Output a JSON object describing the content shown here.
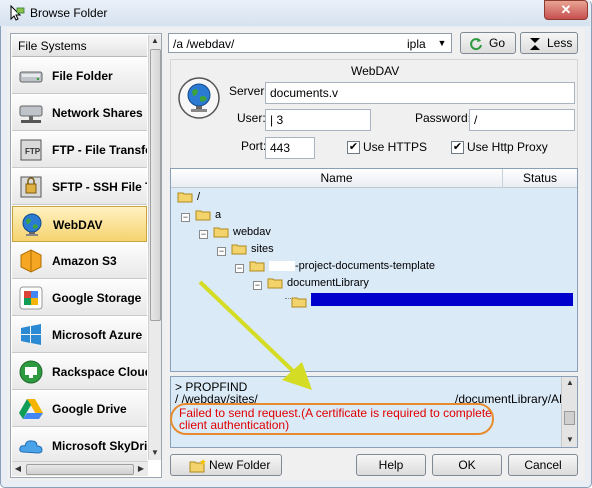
{
  "window": {
    "title": "Browse Folder",
    "close": "✕"
  },
  "file_systems": {
    "header": "File Systems",
    "items": [
      {
        "label": "File Folder",
        "icon": "drive-icon",
        "selected": false
      },
      {
        "label": "Network Shares",
        "icon": "network-drive-icon",
        "selected": false
      },
      {
        "label": "FTP - File Transfer",
        "icon": "ftp-icon",
        "selected": false
      },
      {
        "label": "SFTP - SSH File Tr",
        "icon": "sftp-icon",
        "selected": false
      },
      {
        "label": "WebDAV",
        "icon": "globe-icon",
        "selected": true
      },
      {
        "label": "Amazon S3",
        "icon": "amazon-s3-icon",
        "selected": false
      },
      {
        "label": "Google Storage",
        "icon": "google-icon",
        "selected": false
      },
      {
        "label": "Microsoft Azure",
        "icon": "windows-icon",
        "selected": false
      },
      {
        "label": "Rackspace Cloud",
        "icon": "rackspace-icon",
        "selected": false
      },
      {
        "label": "Google Drive",
        "icon": "google-drive-icon",
        "selected": false
      },
      {
        "label": "Microsoft SkyDriv",
        "icon": "skydrive-icon",
        "selected": false
      }
    ]
  },
  "path": {
    "value": "/a          /webdav/",
    "suffix": "ipla"
  },
  "buttons": {
    "go": "Go",
    "less": "Less",
    "new_folder": "New Folder",
    "help": "Help",
    "ok": "OK",
    "cancel": "Cancel"
  },
  "webdav": {
    "group_label": "WebDAV",
    "server_label": "Server:",
    "server_value": "documents.v",
    "user_label": "User:",
    "user_value": "|            3",
    "password_label": "Password:",
    "password_value": "/",
    "port_label": "Port:",
    "port_value": "443",
    "https_label": "Use HTTPS",
    "https_checked": true,
    "proxy_label": "Use Http Proxy",
    "proxy_checked": true
  },
  "tree": {
    "columns": {
      "name": "Name",
      "status": "Status"
    },
    "nodes": [
      {
        "label": "/"
      },
      {
        "label": "a"
      },
      {
        "label": "webdav"
      },
      {
        "label": "sites"
      },
      {
        "label": "-project-documents-template"
      },
      {
        "label": "documentLibrary"
      },
      {
        "label": ""
      }
    ]
  },
  "log": {
    "line1": "> PROPFIND",
    "line2_start": "/             /webdav/sites/",
    "line2_end": "/documentLibrary/AM",
    "error": "Failed to send request.(A certificate is required to complete client authentication)"
  },
  "colors": {
    "accent": "#0000cc",
    "error": "#e00000",
    "highlight": "#e88b2e",
    "arrow": "#d4dc24"
  }
}
